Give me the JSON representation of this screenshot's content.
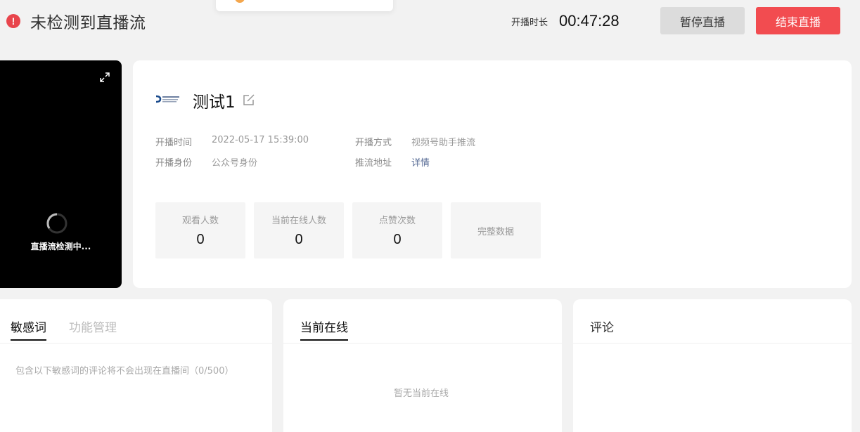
{
  "header": {
    "status_text": "未检测到直播流",
    "duration_label": "开播时长",
    "duration_value": "00:47:28",
    "pause_button": "暂停直播",
    "end_button": "结束直播"
  },
  "preview": {
    "status_text": "直播流检测中..."
  },
  "info": {
    "title": "测试1",
    "start_time_label": "开播时间",
    "start_time_value": "2022-05-17 15:39:00",
    "identity_label": "开播身份",
    "identity_value": "公众号身份",
    "method_label": "开播方式",
    "method_value": "视频号助手推流",
    "push_url_label": "推流地址",
    "push_url_link": "详情",
    "stats": [
      {
        "label": "观看人数",
        "value": "0"
      },
      {
        "label": "当前在线人数",
        "value": "0"
      },
      {
        "label": "点赞次数",
        "value": "0"
      }
    ],
    "full_data_link": "完整数据"
  },
  "panels": {
    "sensitive": {
      "tab_active": "敏感词",
      "tab_inactive": "功能管理",
      "note": "包含以下敏感词的评论将不会出现在直播间（0/500）"
    },
    "online": {
      "tab": "当前在线",
      "empty_text": "暂无当前在线"
    },
    "comments": {
      "title": "评论"
    }
  },
  "colors": {
    "alert": "#e8454c",
    "end_button": "#f24c50",
    "link": "#576b95"
  }
}
